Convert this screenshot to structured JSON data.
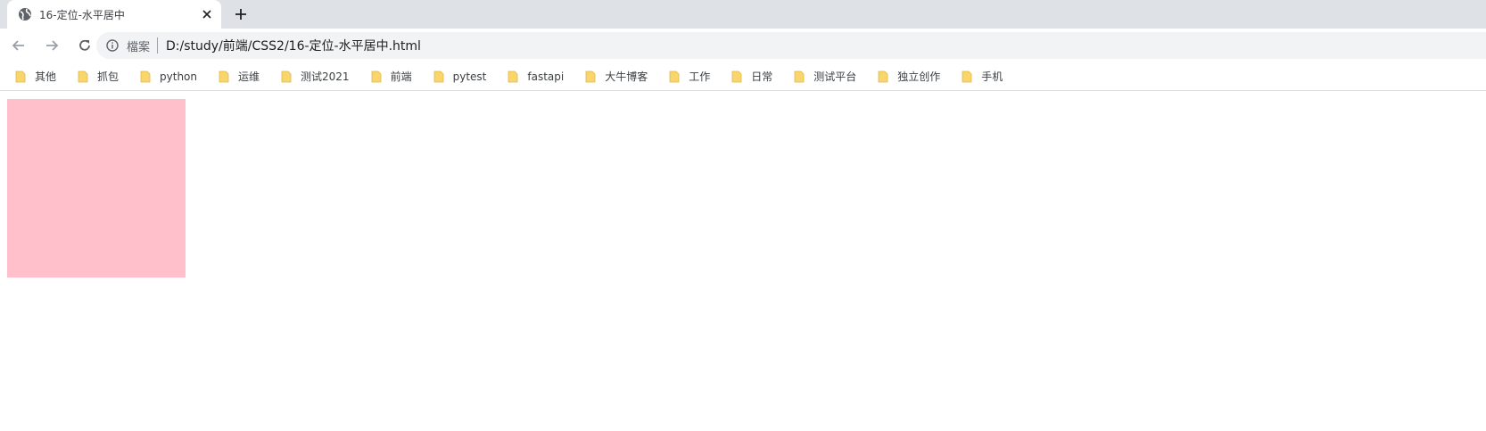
{
  "tab": {
    "title": "16-定位-水平居中",
    "favicon_icon": "globe-icon",
    "close_icon": "close-icon"
  },
  "new_tab_icon": "plus-icon",
  "toolbar": {
    "back_icon": "back-arrow-icon",
    "forward_icon": "forward-arrow-icon",
    "reload_icon": "reload-icon"
  },
  "omnibox": {
    "security_icon": "info-icon",
    "security_label": "檔案",
    "url": "D:/study/前端/CSS2/16-定位-水平居中.html"
  },
  "bookmarks": [
    {
      "label": "其他"
    },
    {
      "label": "抓包"
    },
    {
      "label": "python"
    },
    {
      "label": "运维"
    },
    {
      "label": "测试2021"
    },
    {
      "label": "前端"
    },
    {
      "label": "pytest"
    },
    {
      "label": "fastapi"
    },
    {
      "label": "大牛博客"
    },
    {
      "label": "工作"
    },
    {
      "label": "日常"
    },
    {
      "label": "测试平台"
    },
    {
      "label": "独立创作"
    },
    {
      "label": "手机"
    }
  ],
  "page": {
    "box_color": "#ffc0cb"
  },
  "colors": {
    "tabstrip": "#dee1e6",
    "omnibox": "#f1f3f4",
    "folder": "#f9d66b"
  }
}
